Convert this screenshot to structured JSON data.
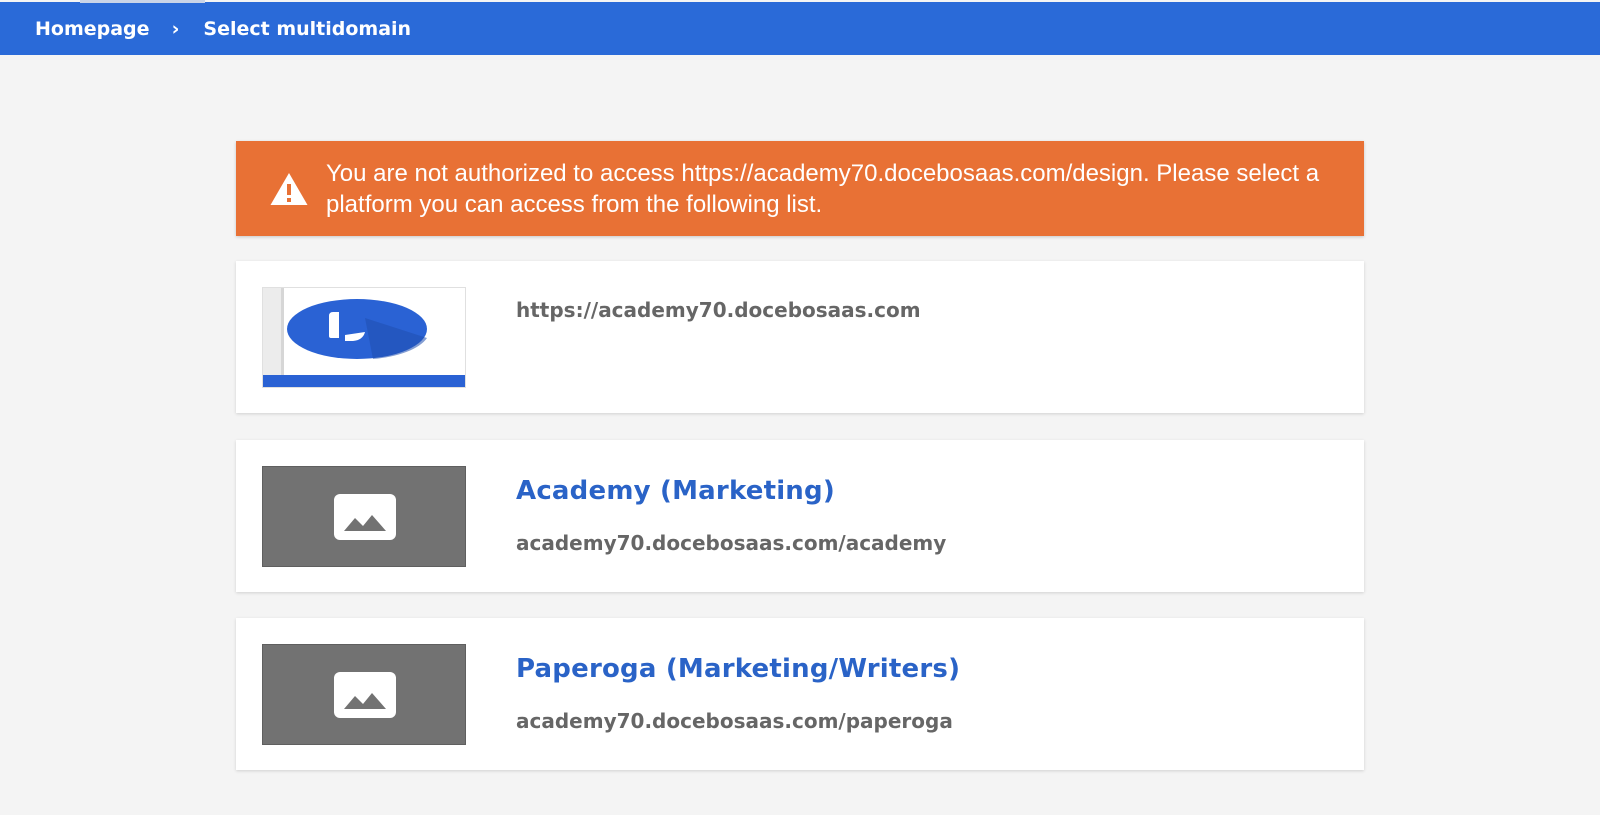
{
  "breadcrumb": {
    "home_label": "Homepage",
    "separator": "›",
    "current_label": "Select multidomain"
  },
  "alert": {
    "icon": "warning-icon",
    "message": "You are not authorized to access https://academy70.docebosaas.com/design. Please select a platform you can access from the following list.",
    "color": "#e87135"
  },
  "platforms": [
    {
      "title": "",
      "url": "https://academy70.docebosaas.com",
      "thumbnail": "docebo-logo"
    },
    {
      "title": "Academy (Marketing)",
      "url": "academy70.docebosaas.com/academy",
      "thumbnail": "image-placeholder-icon"
    },
    {
      "title": "Paperoga (Marketing/Writers)",
      "url": "academy70.docebosaas.com/paperoga",
      "thumbnail": "image-placeholder-icon"
    }
  ],
  "colors": {
    "header": "#2a6ad8",
    "link": "#2a63c7",
    "background": "#f4f4f4"
  }
}
